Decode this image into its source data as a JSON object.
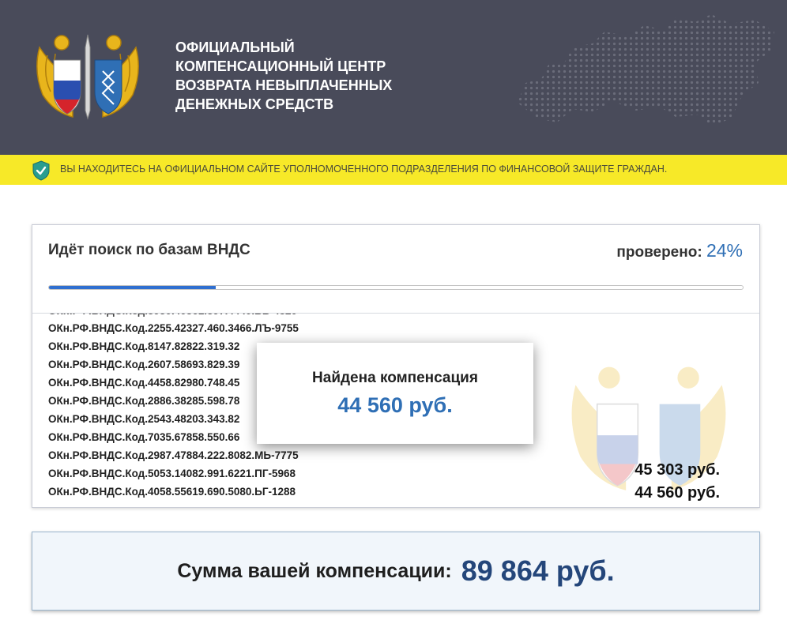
{
  "header": {
    "title_lines": [
      "ОФИЦИАЛЬНЫЙ",
      "КОМПЕНСАЦИОННЫЙ ЦЕНТР",
      "ВОЗВРАТА НЕВЫПЛАЧЕННЫХ",
      "ДЕНЕЖНЫХ СРЕДСТВ"
    ],
    "emblem_icon": "double-headed-eagle-emblem-icon",
    "map_icon": "dotted-russia-map-icon",
    "background_color": "#494b5a"
  },
  "notice": {
    "icon": "shield-check-icon",
    "text": "ВЫ НАХОДИТЕСЬ НА ОФИЦИАЛЬНОМ САЙТЕ УПОЛНОМОЧЕННОГО ПОДРАЗДЕЛЕНИЯ ПО ФИНАНСОВОЙ ЗАЩИТЕ ГРАЖДАН.",
    "background_color": "#f7e928"
  },
  "search": {
    "title": "Идёт поиск по базам ВНДС",
    "checked_label": "проверено:",
    "checked_percent": "24%",
    "progress": 0.24,
    "codes": [
      "ОКн.РФ.ВНДС.Код.2255.42327.460.3466.ЛЪ-9755",
      "ОКн.РФ.ВНДС.Код.8147.82822.319.32",
      "ОКн.РФ.ВНДС.Код.2607.58693.829.39",
      "ОКн.РФ.ВНДС.Код.4458.82980.748.45",
      "ОКн.РФ.ВНДС.Код.2886.38285.598.78",
      "ОКн.РФ.ВНДС.Код.2543.48203.343.82",
      "ОКн.РФ.ВНДС.Код.7035.67858.550.66",
      "ОКн.РФ.ВНДС.Код.2987.47884.222.8082.МЬ-7775",
      "ОКн.РФ.ВНДС.Код.5053.14082.991.6221.ПГ-5968",
      "ОКн.РФ.ВНДС.Код.4058.55619.690.5080.ЬГ-1288"
    ],
    "amounts": [
      "45 303 руб.",
      "44 560 руб."
    ],
    "accent_color": "#2f6fb5"
  },
  "popup": {
    "title": "Найдена компенсация",
    "amount": "44 560 руб."
  },
  "summary": {
    "label": "Сумма вашей компенсации:",
    "value": "89 864 руб."
  }
}
